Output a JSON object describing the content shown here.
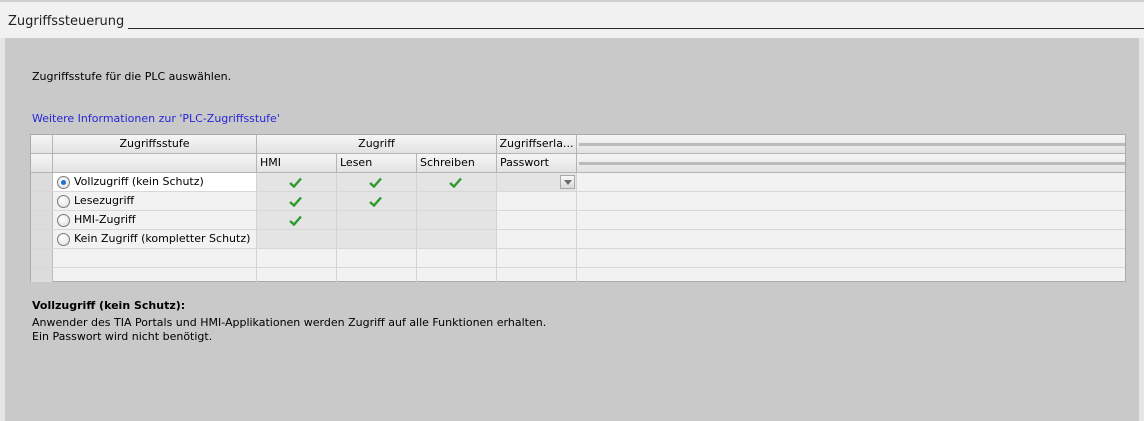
{
  "section": {
    "title": "Zugriffssteuerung"
  },
  "instruction": "Zugriffsstufe für die PLC auswählen.",
  "info_link": "Weitere Informationen zur 'PLC-Zugriffsstufe'",
  "table": {
    "headers": {
      "level": "Zugriffsstufe",
      "access": "Zugriff",
      "permission": "Zugriffserla...",
      "hmi": "HMI",
      "read": "Lesen",
      "write": "Schreiben",
      "password": "Passwort"
    },
    "rows": [
      {
        "label": "Vollzugriff (kein Schutz)",
        "selected": true,
        "hmi": true,
        "read": true,
        "write": true
      },
      {
        "label": "Lesezugriff",
        "selected": false,
        "hmi": true,
        "read": true,
        "write": false
      },
      {
        "label": "HMI-Zugriff",
        "selected": false,
        "hmi": true,
        "read": false,
        "write": false
      },
      {
        "label": "Kein Zugriff (kompletter Schutz)",
        "selected": false,
        "hmi": false,
        "read": false,
        "write": false
      }
    ]
  },
  "description": {
    "title": "Vollzugriff (kein Schutz):",
    "line1": "Anwender des TIA Portals und HMI-Applikationen werden Zugriff auf alle Funktionen erhalten.",
    "line2": "Ein Passwort wird nicht benötigt."
  },
  "colors": {
    "link": "#2626d9",
    "check": "#2e9a2e",
    "radio_dot": "#1f6fd0"
  },
  "icons": {
    "check": "checkmark-icon",
    "dropdown": "chevron-down-icon"
  }
}
